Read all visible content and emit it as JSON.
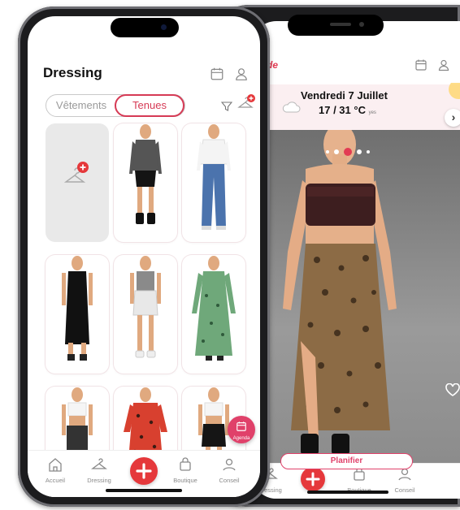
{
  "left_screen": {
    "title": "Dressing",
    "segment": {
      "tabs": [
        "Vêtements",
        "Tenues"
      ],
      "active": "Tenues"
    },
    "fab": {
      "label": "Agenda"
    },
    "nav": {
      "items": [
        "Accueil",
        "Dressing",
        "Boutique",
        "Conseil"
      ]
    }
  },
  "right_screen": {
    "logo": "mode",
    "date": "Vendredi 7 Juillet",
    "temperature": "17 / 31 °C",
    "temperature_note": "yes",
    "carousel": {
      "dot_count": 5,
      "active_index": 2
    },
    "plan_button": "Planifier",
    "nav": {
      "items": [
        "Dressing",
        "Boutique",
        "Conseil"
      ]
    }
  },
  "colors": {
    "accent": "#e23b53",
    "fab": "#e0416a",
    "plus": "#e5383b",
    "band": "#fbeff1"
  },
  "icons": [
    "calendar-icon",
    "user-icon",
    "filter-icon",
    "hanger-add-icon",
    "home-icon",
    "hanger-icon",
    "plus-icon",
    "bag-icon",
    "advice-icon",
    "cloud-icon",
    "sun-icon",
    "heart-icon",
    "chevron-right-icon"
  ]
}
